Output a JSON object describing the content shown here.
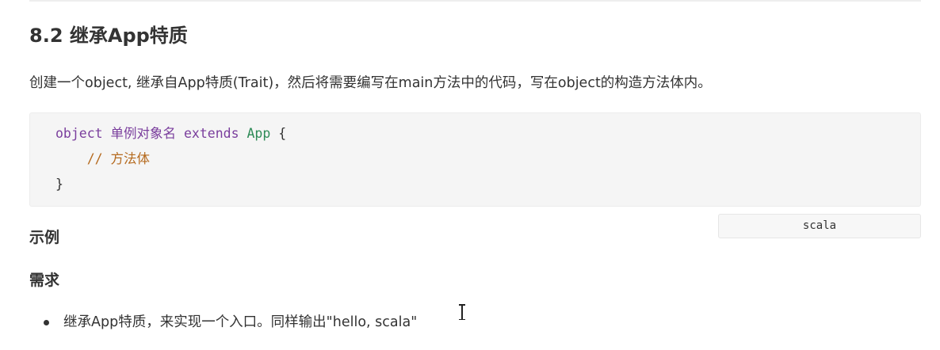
{
  "section": {
    "title": "8.2 继承App特质",
    "description": "创建一个object, 继承自App特质(Trait)，然后将需要编写在main方法中的代码，写在object的构造方法体内。"
  },
  "code_block": {
    "line1": {
      "keyword_object": "object",
      "name": "单例对象名",
      "keyword_extends": "extends",
      "trait": "App",
      "brace_open": "{"
    },
    "line2": {
      "comment": "// 方法体"
    },
    "line3": {
      "brace_close": "}"
    },
    "language": "scala"
  },
  "example": {
    "heading": "示例",
    "requirement_heading": "需求",
    "items": [
      "继承App特质，来实现一个入口。同样输出\"hello, scala\""
    ]
  },
  "colors": {
    "keyword": "#7a3e9d",
    "class_name": "#2e8b57",
    "comment": "#b56a1e",
    "code_background": "#f5f5f5"
  }
}
